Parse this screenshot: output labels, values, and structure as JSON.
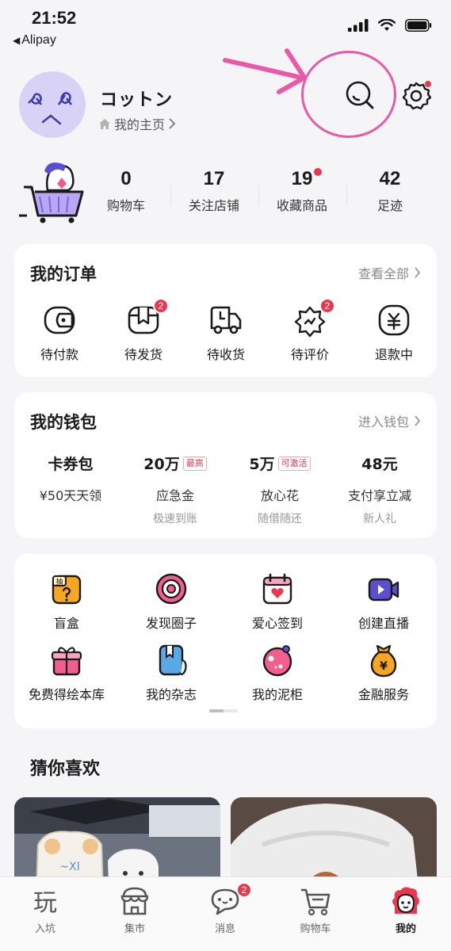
{
  "status_bar": {
    "time": "21:52",
    "back_app": "Alipay"
  },
  "profile": {
    "nickname": "コットン",
    "home_link": "我的主页"
  },
  "stats": [
    {
      "value": "0",
      "label": "购物车"
    },
    {
      "value": "17",
      "label": "关注店铺"
    },
    {
      "value": "19",
      "label": "收藏商品"
    },
    {
      "value": "42",
      "label": "足迹"
    }
  ],
  "orders": {
    "title": "我的订单",
    "more": "查看全部",
    "items": [
      {
        "label": "待付款",
        "icon": "wallet-icon",
        "badge": ""
      },
      {
        "label": "待发货",
        "icon": "package-icon",
        "badge": "2"
      },
      {
        "label": "待收货",
        "icon": "truck-icon",
        "badge": ""
      },
      {
        "label": "待评价",
        "icon": "review-icon",
        "badge": "2"
      },
      {
        "label": "退款中",
        "icon": "refund-icon",
        "badge": ""
      }
    ]
  },
  "wallet": {
    "title": "我的钱包",
    "more": "进入钱包",
    "items": [
      {
        "value": "卡券包",
        "tag": "",
        "label": "¥50天天领",
        "sub": ""
      },
      {
        "value": "20万",
        "tag": "最高",
        "label": "应急金",
        "sub": "极速到账"
      },
      {
        "value": "5万",
        "tag": "可激活",
        "label": "放心花",
        "sub": "随借随还"
      },
      {
        "value": "48元",
        "tag": "",
        "label": "支付享立减",
        "sub": "新人礼"
      }
    ]
  },
  "tools": [
    {
      "label": "盲盒",
      "icon": "blind-box-icon",
      "badge_char": "抽"
    },
    {
      "label": "发现圈子",
      "icon": "discover-circle-icon"
    },
    {
      "label": "爱心签到",
      "icon": "heart-calendar-icon"
    },
    {
      "label": "创建直播",
      "icon": "video-camera-icon"
    },
    {
      "label": "免费得绘本库",
      "icon": "gift-box-icon"
    },
    {
      "label": "我的杂志",
      "icon": "magazine-icon"
    },
    {
      "label": "我的泥柜",
      "icon": "cabinet-cookie-icon"
    },
    {
      "label": "金融服务",
      "icon": "money-bag-icon",
      "badge_char": "¥"
    }
  ],
  "guess": {
    "title": "猜你喜欢"
  },
  "tabs": [
    {
      "label": "入坑",
      "icon": "play-char-icon",
      "icon_char": "玩"
    },
    {
      "label": "集市",
      "icon": "market-icon"
    },
    {
      "label": "消息",
      "icon": "message-icon",
      "badge": "2"
    },
    {
      "label": "购物车",
      "icon": "cart-icon"
    },
    {
      "label": "我的",
      "icon": "profile-mascot-icon"
    }
  ],
  "colors": {
    "accent": "#e8384f",
    "icon_purple": "#5b4fcf",
    "annotation": "#e85aa8",
    "bg": "#f5f5f7"
  }
}
